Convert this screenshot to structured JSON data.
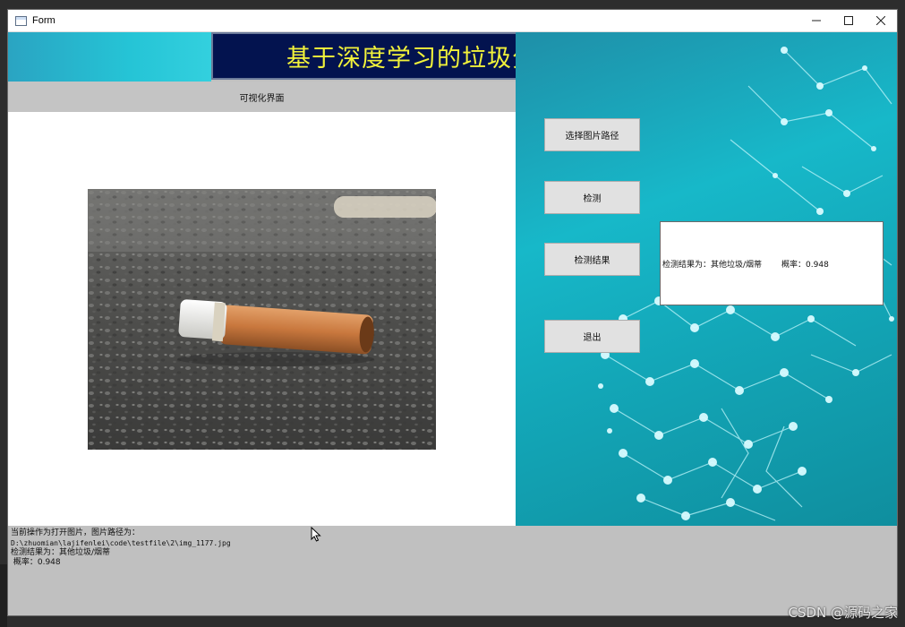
{
  "window": {
    "title": "Form",
    "minimize_glyph": "–",
    "maximize_glyph": "□",
    "close_glyph": "×"
  },
  "header": {
    "title": "基于深度学习的垃圾分类系统"
  },
  "visual_panel": {
    "label": "可视化界面",
    "image_subject": "cigarette butt on gravel"
  },
  "buttons": {
    "select_path": "选择图片路径",
    "detect": "检测",
    "detect_result": "检测结果",
    "exit": "退出"
  },
  "result": {
    "text": "检测结果为：其他垃圾/烟蒂",
    "probability": "概率：0.948"
  },
  "log": {
    "line1": "当前操作为打开图片，图片路径为：",
    "line2": "D:\\zhuomian\\lajifenlei\\code\\testfile\\2\\img_1177.jpg",
    "line3": "检测结果为：其他垃圾/烟蒂",
    "line4": " 概率：0.948"
  },
  "watermark": "CSDN @源码之家",
  "colors": {
    "title_bg": "#03134f",
    "title_text": "#f2f23a",
    "accent_cyan": "#17b8c9"
  }
}
